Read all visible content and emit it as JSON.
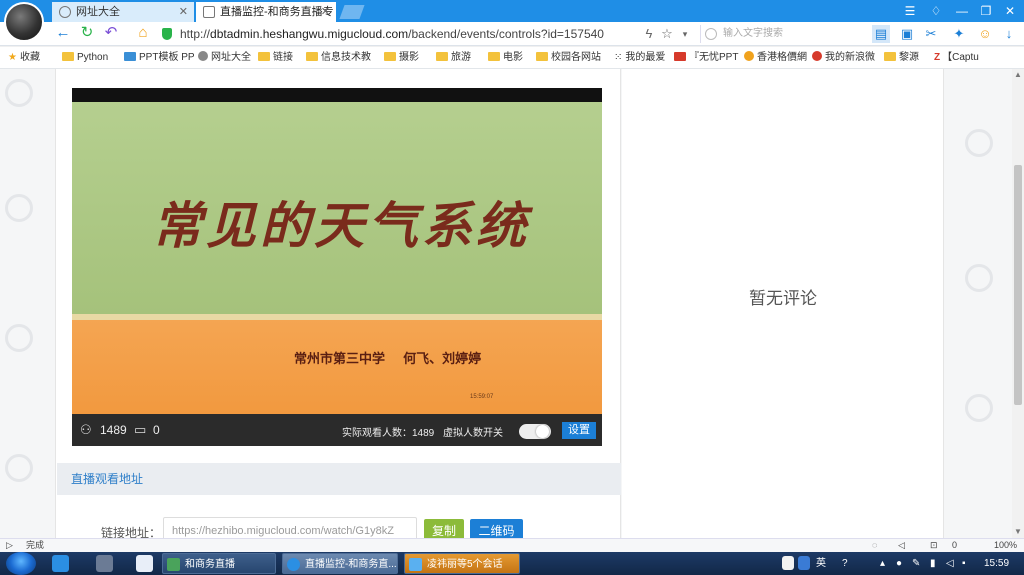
{
  "browser": {
    "tabs": [
      {
        "title": "网址大全"
      },
      {
        "title": "直播监控-和商务直播专"
      }
    ],
    "address": {
      "scheme": "http://",
      "host": "dbtadmin.heshangwu.migucloud.com",
      "path": "/backend/events/controls?id=157540"
    },
    "search_placeholder": "输入文字搜索",
    "bookmarks": [
      "收藏",
      "Python",
      "PPT模板 PP",
      "网址大全",
      "链接",
      "信息技术教",
      "摄影",
      "旅游",
      "电影",
      "校园各网站",
      "我的最爱",
      "『无忧PPT",
      "香港格價網",
      "我的新浪微",
      "黎源",
      "【Captu"
    ],
    "status_text": "完成",
    "zoom": "100%"
  },
  "player": {
    "slide_title": "常见的天气系统",
    "slide_subtitle": "常州市第三中学    何飞、刘婷婷",
    "slide_timestamp": "15:59:07",
    "viewer_count": "1489",
    "comment_count": "0",
    "actual_viewers_label": "实际观看人数：1489",
    "virtual_toggle_label": "虚拟人数开关",
    "settings_label": "设置"
  },
  "watch_section": {
    "heading": "直播观看地址",
    "link_label": "链接地址：",
    "link_value": "https://hezhibo.migucloud.com/watch/G1y8kZ",
    "copy_label": "复制",
    "qr_label": "二维码"
  },
  "comments": {
    "empty_text": "暂无评论"
  },
  "taskbar": {
    "apps": [
      "和商务直播",
      "直播监控-和商务直...",
      "凌祎丽等5个会话"
    ],
    "ime": "英",
    "clock": "15:59"
  },
  "colors": {
    "accent": "#1c7fd6",
    "copy_green": "#8cbb3a",
    "tabbar": "#1f8ee6"
  }
}
